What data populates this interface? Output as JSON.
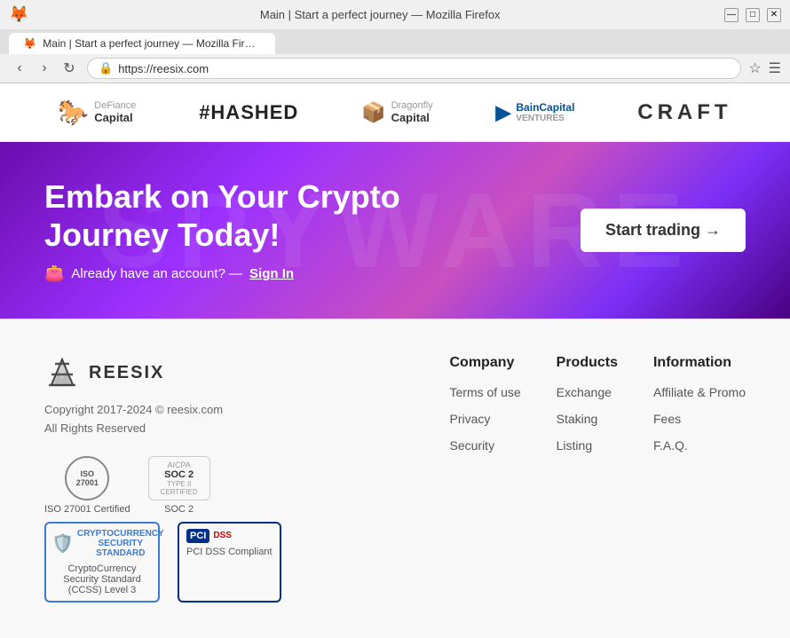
{
  "browser": {
    "tab_title": "Main | Start a perfect journey — Mozilla Firefox",
    "url": "https://reesix.com",
    "favicon": "🦊"
  },
  "investors": [
    {
      "id": "defiance",
      "name": "DeFiance Capital",
      "icon": "🐎"
    },
    {
      "id": "hashed",
      "name": "#HASHED",
      "icon": ""
    },
    {
      "id": "dragonfly",
      "name": "Dragonfly Capital",
      "icon": "📦"
    },
    {
      "id": "bain",
      "name": "Bain Capital Ventures",
      "icon": "▶"
    },
    {
      "id": "craft",
      "name": "CRAFT",
      "icon": ""
    }
  ],
  "hero": {
    "title": "Embark on Your Crypto Journey Today!",
    "subtitle": "Already have an account? —",
    "signin_label": "Sign In",
    "cta_label": "Start trading →",
    "bg_text": "SPYWARE"
  },
  "footer": {
    "logo_text": "REESIX",
    "copyright": "Copyright 2017-2024 © reesix.com\nAll Rights Reserved",
    "iso_label": "ISO 27001 Certified",
    "soc2_label": "SOC 2",
    "ccss_label": "CryptoCurrency Security Standard (CCSS) Level 3",
    "pci_label": "PCI DSS Compliant",
    "columns": [
      {
        "heading": "Company",
        "links": [
          "Terms of use",
          "Privacy",
          "Security"
        ]
      },
      {
        "heading": "Products",
        "links": [
          "Exchange",
          "Staking",
          "Listing"
        ]
      },
      {
        "heading": "Information",
        "links": [
          "Affiliate & Promo",
          "Fees",
          "F.A.Q."
        ]
      }
    ]
  }
}
